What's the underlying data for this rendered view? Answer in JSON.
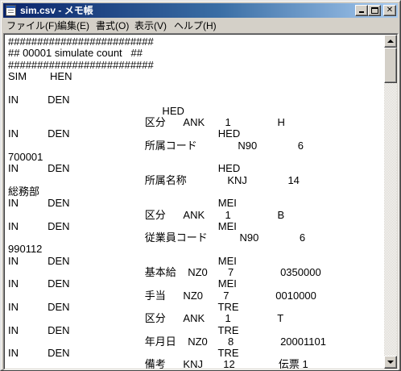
{
  "window": {
    "title": "sim.csv - メモ帳"
  },
  "menu": [
    {
      "label": "ファイル(F)"
    },
    {
      "label": "編集(E)"
    },
    {
      "label": "書式(O)"
    },
    {
      "label": "表示(V)"
    },
    {
      "label": "ヘルプ(H)"
    }
  ],
  "document": {
    "lines": [
      "#########################",
      "## 00001 simulate count   ##",
      "#########################",
      "SIM        HEN",
      "",
      "IN          DEN",
      "                                                     HED",
      "                                               区分      ANK       1                H",
      "IN          DEN                                                   HED",
      "                                               所属コード              N90              6",
      "700001",
      "IN          DEN                                                   HED",
      "                                               所属名称              KNJ              14",
      "総務部",
      "IN          DEN                                                   MEI",
      "                                               区分      ANK       1                B",
      "IN          DEN                                                   MEI",
      "                                               従業員コード           N90              6",
      "990112",
      "IN          DEN                                                   MEI",
      "                                               基本給    NZ0       7                0350000",
      "IN          DEN                                                   MEI",
      "                                               手当      NZ0       7                0010000",
      "IN          DEN                                                   TRE",
      "                                               区分      ANK       1                T",
      "IN          DEN                                                   TRE",
      "                                               年月日    NZ0       8                20001101",
      "IN          DEN                                                   TRE",
      "                                               備考      KNJ       12               伝票 1"
    ]
  }
}
